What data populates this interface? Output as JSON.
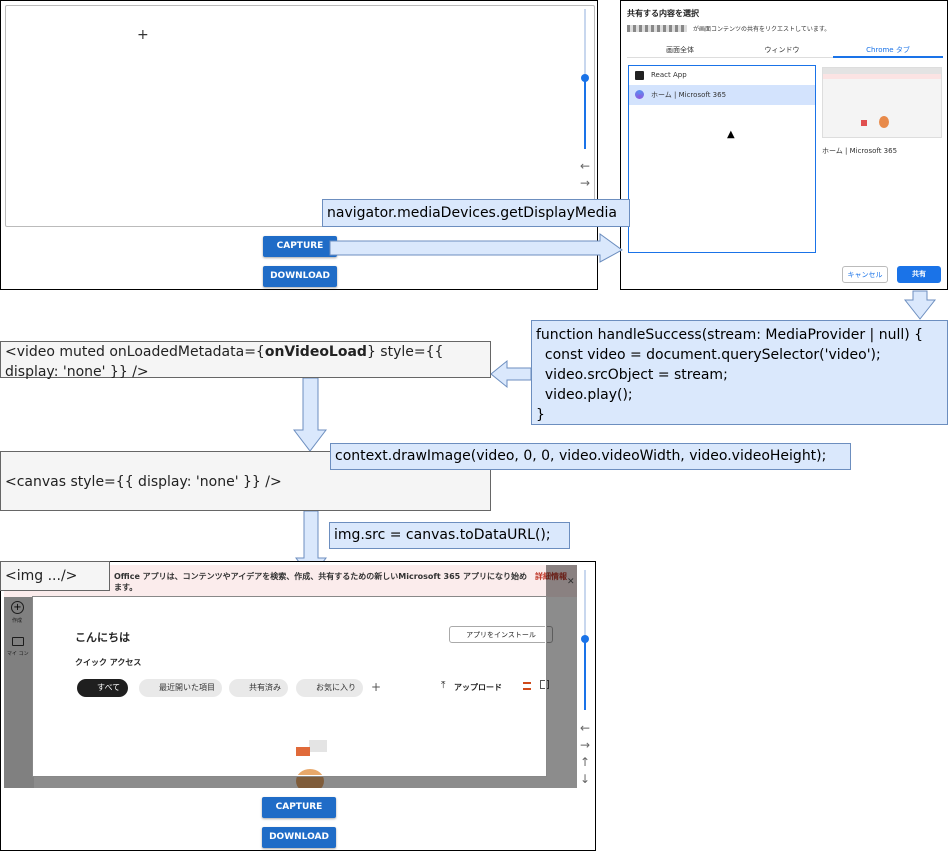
{
  "top_app": {
    "crosshair": "+",
    "capture_label": "CAPTURE",
    "download_label": "DOWNLOAD"
  },
  "dialog": {
    "title": "共有する内容を選択",
    "subtitle": "が画面コンテンツの共有をリクエストしています。",
    "tabs": [
      "画面全体",
      "ウィンドウ",
      "Chrome タブ"
    ],
    "items": [
      "React App",
      "ホーム | Microsoft 365"
    ],
    "preview_caption": "ホーム | Microsoft 365",
    "cancel_label": "キャンセル",
    "share_label": "共有",
    "accent": "#1a73e8"
  },
  "labels": {
    "getdisplaymedia": "navigator.mediaDevices.getDisplayMedia",
    "handle_success": [
      "function handleSuccess(stream: MediaProvider | null) {",
      "  const video = document.querySelector('video');",
      "  video.srcObject = stream;",
      "  video.play();",
      "}"
    ],
    "video_prefix": "<video muted onLoadedMetadata={",
    "video_bold": "onVideoLoad",
    "video_suffix": "} style={{ display: 'none' }} />",
    "canvas_tag": "<canvas style={{ display: 'none' }} />",
    "draw_image": "context.drawImage(video, 0, 0, video.videoWidth, video.videoHeight);",
    "to_data_url": "img.src = canvas.toDataURL();",
    "img_tag": "<img .../>"
  },
  "bottom_app": {
    "banner": "Office アプリは、コンテンツやアイデアを検索、作成、共有するための新しいMicrosoft 365 アプリになり始めます。",
    "banner_tail": "詳細情報",
    "banner_prefix": "",
    "side_items": [
      "作成",
      "マイ コン"
    ],
    "greeting": "こんにちは",
    "install_button": "アプリをインストール",
    "quick_access": "クイック アクセス",
    "chips": [
      "すべて",
      "最近開いた項目",
      "共有済み",
      "お気に入り"
    ],
    "plus": "+",
    "upload": "アップロード",
    "capture_label": "CAPTURE",
    "download_label": "DOWNLOAD"
  },
  "colors": {
    "button_blue": "#1f6cc7",
    "slider_blue": "#1a73e8",
    "callout_fill": "#dae8fc",
    "callout_border": "#6c8ebf",
    "box_fill": "#f5f5f5"
  }
}
